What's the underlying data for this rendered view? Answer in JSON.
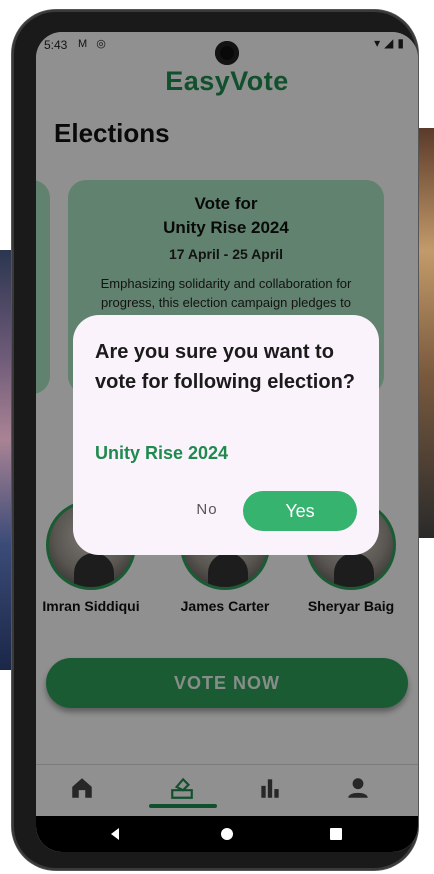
{
  "status_bar": {
    "time": "5:43",
    "left_icons": "M ◎",
    "right_icons": "▾◢▮"
  },
  "app": {
    "title": "EasyVote"
  },
  "page": {
    "title": "Elections"
  },
  "election_card": {
    "vote_for": "Vote for",
    "name": "Unity Rise 2024",
    "dates": "17 April  - 25 April",
    "description": "Emphasizing solidarity and collaboration for progress, this election campaign pledges to"
  },
  "candidates": [
    {
      "name": "Imran Siddiqui"
    },
    {
      "name": "James Carter"
    },
    {
      "name": "Sheryar Baig"
    }
  ],
  "vote_button": {
    "label": "VOTE NOW"
  },
  "bottom_nav": [
    {
      "icon": "home-icon"
    },
    {
      "icon": "ballot-box-icon",
      "selected": true
    },
    {
      "icon": "bar-chart-icon"
    },
    {
      "icon": "person-icon"
    }
  ],
  "dialog": {
    "question": "Are you sure you want to vote for following election?",
    "election_name": "Unity Rise 2024",
    "no_label": "No",
    "yes_label": "Yes"
  },
  "colors": {
    "brand": "#1e8a4f",
    "card": "#a8e1c0",
    "accent_button": "#36b36e",
    "dialog_bg": "#fbf3fb"
  }
}
